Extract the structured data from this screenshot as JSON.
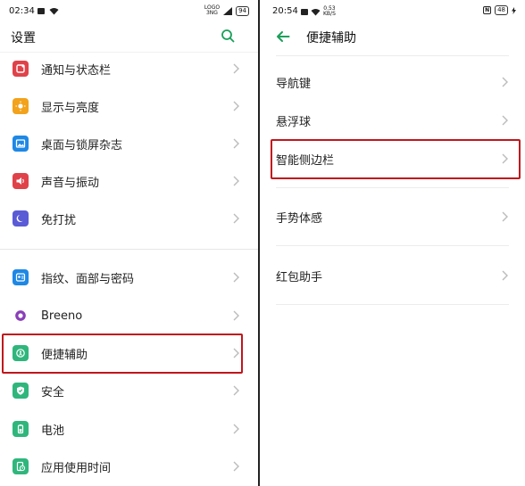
{
  "left": {
    "status": {
      "time": "02:34",
      "battery": "94",
      "carrier": "LOGO\n3NG"
    },
    "header": {
      "title": "设置"
    },
    "items_group1": [
      {
        "label": "通知与状态栏",
        "icon": "notification-icon",
        "color": "#e0424a"
      },
      {
        "label": "显示与亮度",
        "icon": "brightness-icon",
        "color": "#f2a21b"
      },
      {
        "label": "桌面与锁屏杂志",
        "icon": "wallpaper-icon",
        "color": "#1e88e5"
      },
      {
        "label": "声音与振动",
        "icon": "sound-icon",
        "color": "#e0424a"
      },
      {
        "label": "免打扰",
        "icon": "moon-icon",
        "color": "#5b5bd6"
      }
    ],
    "items_group2": [
      {
        "label": "指纹、面部与密码",
        "icon": "fingerprint-icon",
        "color": "#1e88e5"
      },
      {
        "label": "Breeno",
        "icon": "breeno-icon",
        "color": "#8a3fb8"
      },
      {
        "label": "便捷辅助",
        "icon": "accessibility-icon",
        "color": "#2fb67c"
      },
      {
        "label": "安全",
        "icon": "shield-icon",
        "color": "#2fb67c"
      },
      {
        "label": "电池",
        "icon": "battery-icon",
        "color": "#2fb67c"
      },
      {
        "label": "应用使用时间",
        "icon": "app-time-icon",
        "color": "#2fb67c"
      }
    ]
  },
  "right": {
    "status": {
      "time": "20:54",
      "speed": "0.53\nKB/S",
      "battery": "48"
    },
    "header": {
      "title": "便捷辅助"
    },
    "items": [
      {
        "label": "导航键"
      },
      {
        "label": "悬浮球"
      },
      {
        "label": "智能侧边栏"
      },
      {
        "label": "手势体感"
      },
      {
        "label": "红包助手"
      }
    ]
  },
  "colors": {
    "accent": "#1aa05a",
    "highlight": "#c0161c"
  }
}
